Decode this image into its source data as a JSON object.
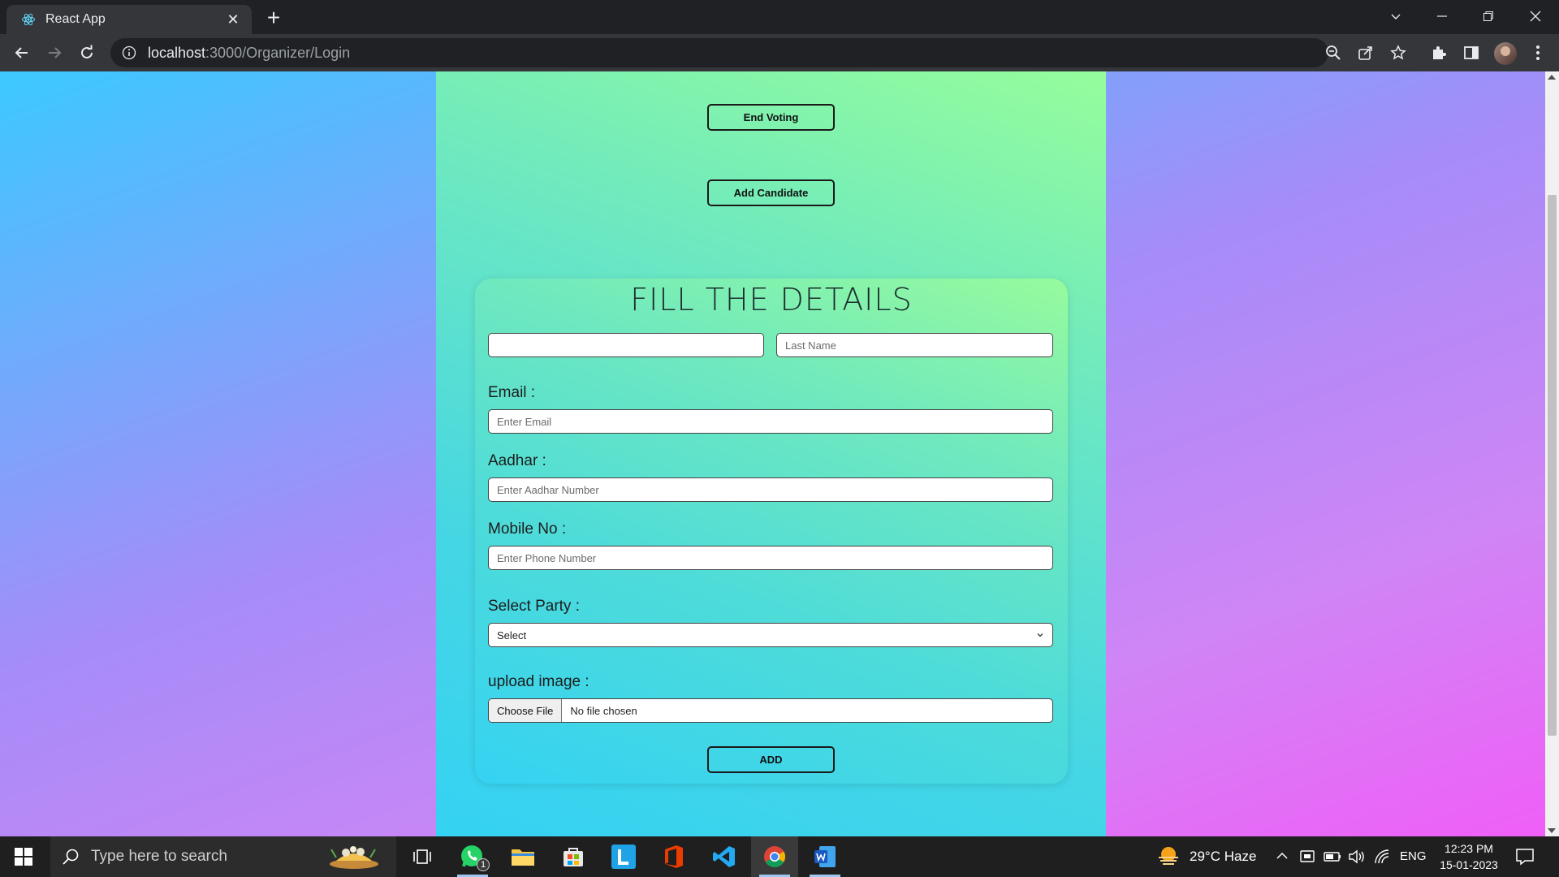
{
  "browser": {
    "tab_title": "React App",
    "url_host": "localhost",
    "url_path": ":3000/Organizer/Login"
  },
  "page": {
    "end_voting_label": "End Voting",
    "add_candidate_label": "Add Candidate",
    "form": {
      "title": "FILL THE DETAILS",
      "first_name_value": "",
      "last_name_placeholder": "Last Name",
      "email_label": "Email :",
      "email_placeholder": "Enter Email",
      "aadhar_label": "Aadhar :",
      "aadhar_placeholder": "Enter Aadhar Number",
      "mobile_label": "Mobile No :",
      "mobile_placeholder": "Enter Phone Number",
      "party_label": "Select Party :",
      "party_selected": "Select",
      "upload_label": "upload image :",
      "choose_file_label": "Choose File",
      "file_status": "No file chosen",
      "add_label": "ADD"
    }
  },
  "taskbar": {
    "search_placeholder": "Type here to search",
    "whatsapp_badge": "1",
    "weather": "29°C  Haze",
    "language": "ENG",
    "time": "12:23 PM",
    "date": "15-01-2023"
  },
  "colors": {
    "page_gradient": [
      "#3cc9ff",
      "#a58cf8",
      "#f05ef7"
    ],
    "panel_gradient": [
      "#95fd9b",
      "#35d2f3"
    ]
  }
}
